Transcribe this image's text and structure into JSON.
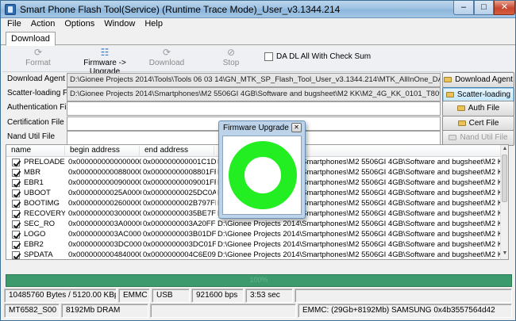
{
  "window": {
    "title": "Smart Phone Flash Tool(Service) (Runtime Trace Mode)_User_v3.1344.214",
    "controls": {
      "minimize": "–",
      "maximize": "□",
      "close": "✕"
    }
  },
  "menu": [
    "File",
    "Action",
    "Options",
    "Window",
    "Help"
  ],
  "tabs": [
    "Download"
  ],
  "toolbar": {
    "format": {
      "label": "Format",
      "icon": "format-icon"
    },
    "mode_select": {
      "label": "Firmware -> Upgrade",
      "icon": "firmware-upgrade-icon"
    },
    "download": {
      "label": "Download",
      "icon": "download-icon"
    },
    "stop": {
      "label": "Stop",
      "icon": "stop-icon"
    },
    "da_checksum": {
      "label": "DA DL All With Check Sum",
      "checked": false
    }
  },
  "fields": {
    "download_agent": {
      "label": "Download Agent",
      "value": "D:\\Gionee Projects 2014\\Tools\\Tools 06 03 14\\GN_MTK_SP_Flash_Tool_User_v3.1344.214\\MTK_AllInOne_DA.bin",
      "button": "Download Agent"
    },
    "scatter": {
      "label": "Scatter-loading File",
      "value": "D:\\Gionee Projects 2014\\Smartphones\\M2 5506GI 4GB\\Software and bugsheet\\M2 KK\\M2_4G_KK_0101_T8090_020914 3 I",
      "button": "Scatter-loading"
    },
    "auth": {
      "label": "Authentication File",
      "value": "",
      "button": "Auth File"
    },
    "cert": {
      "label": "Certification File",
      "value": "",
      "button": "Cert File"
    },
    "nand": {
      "label": "Nand Util File",
      "value": "",
      "button": "Nand Util File"
    }
  },
  "table": {
    "headers": [
      "name",
      "begin address",
      "end address",
      "l"
    ],
    "rows": [
      {
        "name": "PRELOADER",
        "begin": "0x0000000000000000",
        "end": "0x000000000001C1D3",
        "loc": "D:\\Gionee Projects 2014\\Smartphones\\M2 5506GI 4GB\\Software and bugsheet\\M2 KK\\M2_4G_",
        "checked": true
      },
      {
        "name": "MBR",
        "begin": "0x0000000000880000",
        "end": "0x00000000008801FF",
        "loc": "D:\\Gionee Projects 2014\\Smartphones\\M2 5506GI 4GB\\Software and bugsheet\\M2 KK\\M2_4G_",
        "checked": true
      },
      {
        "name": "EBR1",
        "begin": "0x0000000000900000",
        "end": "0x00000000009001FF",
        "loc": "D:\\Gionee Projects 2014\\Smartphones\\M2 5506GI 4GB\\Software and bugsheet\\M2 KK\\M2_4G_",
        "checked": true
      },
      {
        "name": "UBOOT",
        "begin": "0x00000000025A0000",
        "end": "0x00000000025DC0A7",
        "loc": "D:\\Gionee Projects 2014\\Smartphones\\M2 5506GI 4GB\\Software and bugsheet\\M2 KK\\M2_4G_",
        "checked": true
      },
      {
        "name": "BOOTIMG",
        "begin": "0x0000000002600000",
        "end": "0x0000000002B797FF",
        "loc": "D:\\Gionee Projects 2014\\Smartphones\\M2 5506GI 4GB\\Software and bugsheet\\M2 KK\\M2_4G_",
        "checked": true
      },
      {
        "name": "RECOVERY",
        "begin": "0x0000000003000000",
        "end": "0x00000000035BE7FF",
        "loc": "D:\\Gionee Projects 2014\\Smartphones\\M2 5506GI 4GB\\Software and bugsheet\\M2 KK\\M2_4G_",
        "checked": true
      },
      {
        "name": "SEC_RO",
        "begin": "0x0000000003A00000",
        "end": "0x0000000003A20FFF",
        "loc": "D:\\Gionee Projects 2014\\Smartphones\\M2 5506GI 4GB\\Software and bugsheet\\M2 KK\\M2_4G_",
        "checked": true
      },
      {
        "name": "LOGO",
        "begin": "0x0000000003AC0000",
        "end": "0x0000000003B01DFF",
        "loc": "D:\\Gionee Projects 2014\\Smartphones\\M2 5506GI 4GB\\Software and bugsheet\\M2 KK\\M2_4G_",
        "checked": true
      },
      {
        "name": "EBR2",
        "begin": "0x0000000003DC0000",
        "end": "0x0000000003DC01FF",
        "loc": "D:\\Gionee Projects 2014\\Smartphones\\M2 5506GI 4GB\\Software and bugsheet\\M2 KK\\M2_4G_",
        "checked": true
      },
      {
        "name": "SPDATA",
        "begin": "0x0000000004840000",
        "end": "0x0000000004C6E093",
        "loc": "D:\\Gionee Projects 2014\\Smartphones\\M2 5506GI 4GB\\Software and bugsheet\\M2 KK\\M2_4G_",
        "checked": true
      }
    ]
  },
  "progress": {
    "text": "100%",
    "value": 1.0,
    "color": "#3d9a6d"
  },
  "status1": [
    "10485760 Bytes / 5120.00 KBps",
    "EMMC",
    "USB",
    "921600 bps",
    "3:53 sec"
  ],
  "status2": [
    "MT6582_S00",
    "8192Mb DRAM",
    "",
    "EMMC: (29Gb+8192Mb) SAMSUNG 0x4b3557564d42"
  ],
  "dialog": {
    "title": "Firmware Upgrade ...",
    "close": "✕",
    "ring_color": "#22ee22"
  }
}
